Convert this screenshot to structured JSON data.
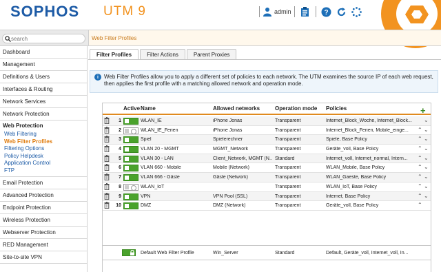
{
  "header": {
    "brand": "SOPHOS",
    "product": "UTM 9",
    "user": "admin"
  },
  "search": {
    "placeholder": "search"
  },
  "breadcrumb": "Web Filter Profiles",
  "sidebar": {
    "items_top": [
      "Dashboard",
      "Management",
      "Definitions & Users",
      "Interfaces & Routing",
      "Network Services",
      "Network Protection"
    ],
    "group": {
      "title": "Web Protection",
      "subitems": [
        "Web Filtering",
        "Web Filter Profiles",
        "Filtering Options",
        "Policy Helpdesk",
        "Application Control",
        "FTP"
      ]
    },
    "items_bottom": [
      "Email Protection",
      "Advanced Protection",
      "Endpoint Protection",
      "Wireless Protection",
      "Webserver Protection",
      "RED Management",
      "Site-to-site VPN"
    ]
  },
  "tabs": [
    "Filter Profiles",
    "Filter Actions",
    "Parent Proxies"
  ],
  "info": {
    "line1": "Web Filter Profiles allow you to apply a different set of policies to each network. The UTM examines the source IP of each web request,",
    "line2": "then applies the first profile with a matching allowed network and operation mode."
  },
  "table": {
    "headers": {
      "active": "Active",
      "name": "Name",
      "networks": "Allowed networks",
      "mode": "Operation mode",
      "policies": "Policies"
    },
    "rows": [
      {
        "num": "1",
        "active": true,
        "name": "WLAN_IE",
        "networks": "iPhone Jonas",
        "mode": "Transparent",
        "policies": "Internet_Block_Woche, Internet_Block...",
        "up": false,
        "down": true
      },
      {
        "num": "2",
        "active": false,
        "name": "WLAN_IE_Ferien",
        "networks": "iPhone Jonas",
        "mode": "Transparent",
        "policies": "Internet_Block_Ferien, Mobile_einge...",
        "up": true,
        "down": true
      },
      {
        "num": "3",
        "active": true,
        "name": "Spiel",
        "networks": "Spielerechner",
        "mode": "Transparent",
        "policies": "Spiele, Base Policy",
        "up": true,
        "down": true
      },
      {
        "num": "4",
        "active": true,
        "name": "VLAN 20 - MGMT",
        "networks": "MGMT_Network",
        "mode": "Transparent",
        "policies": "Geräte_voll, Base Policy",
        "up": true,
        "down": true
      },
      {
        "num": "5",
        "active": true,
        "name": "VLAN 30 - LAN",
        "networks": "Client_Network, MGMT (N...",
        "mode": "Standard",
        "policies": "Internet_voll, Internet_normal, Intern...",
        "up": true,
        "down": true
      },
      {
        "num": "6",
        "active": true,
        "name": "VLAN 660 - Mobile",
        "networks": "Mobile (Network)",
        "mode": "Transparent",
        "policies": "WLAN_Mobile, Base Policy",
        "up": true,
        "down": true
      },
      {
        "num": "7",
        "active": true,
        "name": "VLAN 666 - Gäste",
        "networks": "Gäste (Network)",
        "mode": "Transparent",
        "policies": "WLAN_Gaeste, Base Policy",
        "up": true,
        "down": true
      },
      {
        "num": "8",
        "active": false,
        "name": "WLAN_IoT",
        "networks": "",
        "mode": "Transparent",
        "policies": "WLAN_IoT, Base Policy",
        "up": true,
        "down": true
      },
      {
        "num": "9",
        "active": true,
        "name": "VPN",
        "networks": "VPN Pool (SSL)",
        "mode": "Transparent",
        "policies": "Internet, Base Policy",
        "up": true,
        "down": true
      },
      {
        "num": "10",
        "active": true,
        "name": "DMZ",
        "networks": "DMZ (Network)",
        "mode": "Transparent",
        "policies": "Geräte_voll, Base Policy",
        "up": true,
        "down": false
      }
    ],
    "default_row": {
      "name": "Default Web Filter Profile",
      "networks": "Win_Server",
      "mode": "Standard",
      "policies": "Default, Geräte_voll, Internet_voll, In..."
    }
  },
  "colors": {
    "brand_blue": "#1d5ba6",
    "accent_orange": "#f29320",
    "active_green": "#4aa22c"
  }
}
